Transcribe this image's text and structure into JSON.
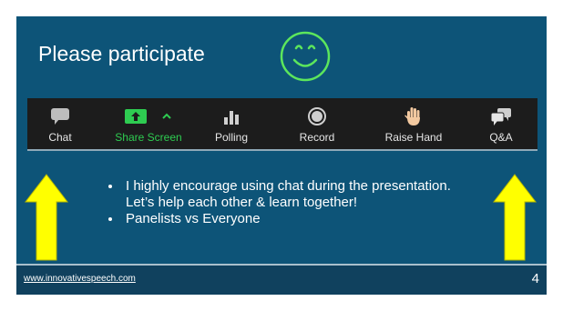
{
  "slide": {
    "title": "Please participate",
    "page_number": "4",
    "footer_url": "www.innovativespeech.com"
  },
  "toolbar": {
    "items": [
      {
        "label": "Chat",
        "icon": "chat-bubble-icon"
      },
      {
        "label": "Share Screen",
        "icon": "share-screen-icon",
        "color": "#2ecc51"
      },
      {
        "label": "Polling",
        "icon": "bar-chart-icon"
      },
      {
        "label": "Record",
        "icon": "record-icon"
      },
      {
        "label": "Raise Hand",
        "icon": "hand-icon"
      },
      {
        "label": "Q&A",
        "icon": "qa-bubbles-icon"
      }
    ]
  },
  "bullets": [
    "I highly encourage using chat during the presentation. Let’s help each other & learn together!",
    "Panelists vs Everyone"
  ],
  "colors": {
    "panel_bg": "#0d5478",
    "toolbar_bg": "#1c1c1c",
    "arrow_fill": "#ffff00",
    "smiley_stroke": "#5ce65c"
  }
}
